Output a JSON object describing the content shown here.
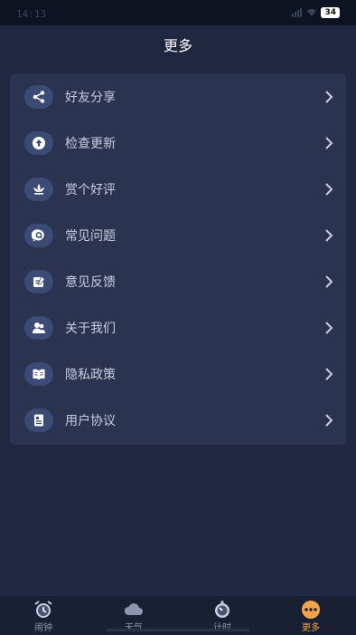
{
  "status_bar": {
    "time": "14:13",
    "battery": "34"
  },
  "header": {
    "title": "更多"
  },
  "menu": {
    "items": [
      {
        "label": "好友分享",
        "icon": "share-icon"
      },
      {
        "label": "检查更新",
        "icon": "upload-icon"
      },
      {
        "label": "赏个好评",
        "icon": "lotus-icon"
      },
      {
        "label": "常见问题",
        "icon": "question-chat-icon"
      },
      {
        "label": "意见反馈",
        "icon": "feedback-icon"
      },
      {
        "label": "关于我们",
        "icon": "people-icon"
      },
      {
        "label": "隐私政策",
        "icon": "book-icon"
      },
      {
        "label": "用户协议",
        "icon": "document-icon"
      }
    ]
  },
  "bottom_nav": {
    "items": [
      {
        "label": "闹钟",
        "icon": "alarm-clock-icon"
      },
      {
        "label": "天气",
        "icon": "cloud-icon"
      },
      {
        "label": "计时",
        "icon": "stopwatch-icon"
      },
      {
        "label": "更多",
        "icon": "more-icon",
        "active": true
      }
    ]
  },
  "colors": {
    "background": "#1f2741",
    "card": "#2a3350",
    "icon_badge": "#3c4b76",
    "accent": "#f2a44a"
  }
}
